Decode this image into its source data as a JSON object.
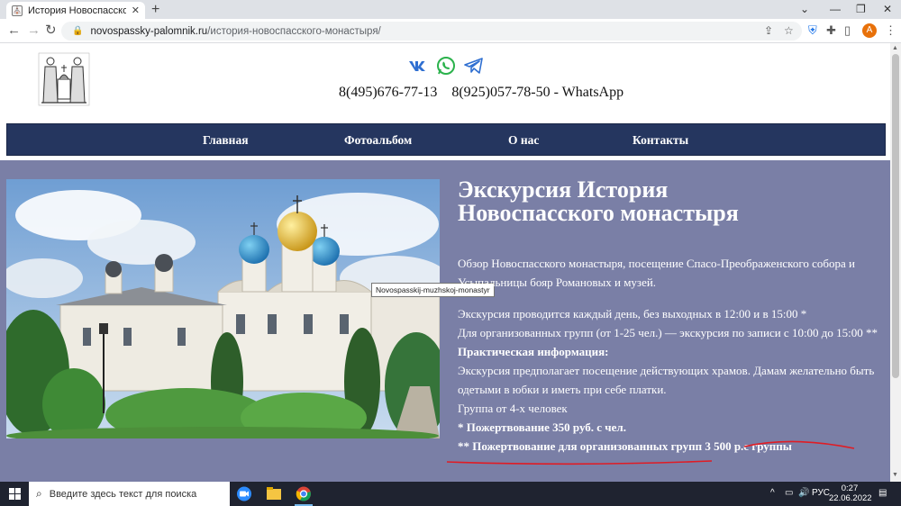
{
  "browser": {
    "tab_title": "История Новоспасского монастыря",
    "tab_favicon": "church-favicon-icon",
    "url_domain": "novospassky-palomnik.ru",
    "url_path": "/история-новоспасского-монастыря/",
    "avatar_letter": "A",
    "avatar_color": "#e8710a"
  },
  "header": {
    "phone1": "8(495)676-77-13",
    "phone2": "8(925)057-78-50 - WhatsApp",
    "socials": [
      "vk-icon",
      "whatsapp-icon",
      "telegram-icon"
    ]
  },
  "menu": {
    "items": [
      "Главная",
      "Фотоальбом",
      "О нас",
      "Контакты"
    ],
    "bg_color": "#25365f"
  },
  "content": {
    "bg_color": "#7a7fa6",
    "image_tooltip": "Novospasskij-muzhskoj-monastyr",
    "title": "Экскурсия История Новоспасского монастыря",
    "intro": "Обзор Новоспасского монастыря, посещение Спасо-Преображенского собора и Усыпальницы бояр Романовых и музей.",
    "schedule": "Экскурсия проводится каждый день, без выходных в 12:00 и в 15:00 *",
    "groups": "Для организованных групп (от 1-25 чел.) — экскурсия по записи с 10:00 до 15:00 **",
    "practical_heading": "Практическая информация:",
    "practical_text": "Экскурсия предполагает посещение действующих храмов. Дамам желательно быть одетыми в юбки и иметь при себе платки.",
    "group_size": "Группа от 4-х человек",
    "donation1": "* Пожертвование 350 руб. с чел.",
    "donation2": "** Пожертвование для организованных групп 3 500 р.с группы"
  },
  "taskbar": {
    "search_placeholder": "Введите здесь текст для поиска",
    "lang": "РУС",
    "time": "0:27",
    "date": "22.06.2022"
  }
}
